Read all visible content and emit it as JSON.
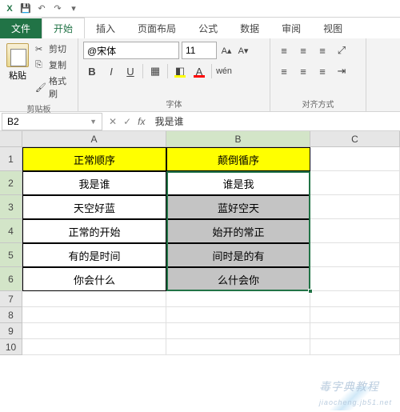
{
  "qat": {
    "save_tip": "保存",
    "undo_tip": "撤销",
    "redo_tip": "重做"
  },
  "tabs": {
    "file": "文件",
    "home": "开始",
    "insert": "插入",
    "pagelayout": "页面布局",
    "formulas": "公式",
    "data": "数据",
    "review": "审阅",
    "view": "视图"
  },
  "ribbon": {
    "clipboard": {
      "paste": "粘贴",
      "cut": "剪切",
      "copy": "复制",
      "format_painter": "格式刷",
      "label": "剪贴板"
    },
    "font": {
      "name": "@宋体",
      "size": "11",
      "label": "字体"
    },
    "align": {
      "label": "对齐方式"
    }
  },
  "formula_bar": {
    "cell_ref": "B2",
    "fx": "fx",
    "value": "我是谁"
  },
  "columns": {
    "A": "A",
    "B": "B",
    "C": "C"
  },
  "rows": [
    "1",
    "2",
    "3",
    "4",
    "5",
    "6",
    "7",
    "8",
    "9",
    "10"
  ],
  "sheet": {
    "header": {
      "A": "正常顺序",
      "B": "颠倒循序"
    },
    "data": [
      {
        "A": "我是谁",
        "B": "谁是我"
      },
      {
        "A": "天空好蓝",
        "B": "蓝好空天"
      },
      {
        "A": "正常的开始",
        "B": "始开的常正"
      },
      {
        "A": "有的是时间",
        "B": "间时是的有"
      },
      {
        "A": "你会什么",
        "B": "么什会你"
      }
    ]
  },
  "watermark": "毒字典教程",
  "watermark_sub": "jiaocheng.jb51.net"
}
